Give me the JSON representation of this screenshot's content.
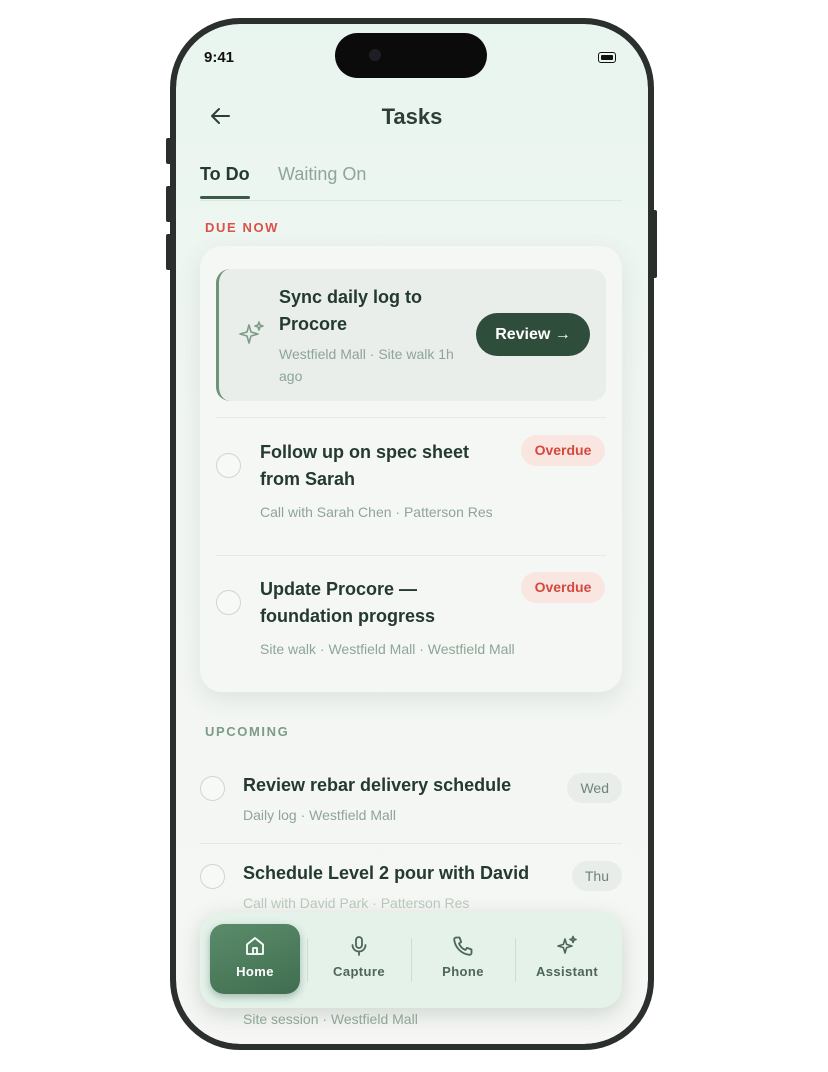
{
  "status": {
    "time": "9:41"
  },
  "header": {
    "title": "Tasks"
  },
  "tabs": [
    {
      "label": "To Do"
    },
    {
      "label": "Waiting On"
    }
  ],
  "due_now": {
    "label": "DUE NOW",
    "hero": {
      "title": "Sync daily log to Procore",
      "meta": "Westfield Mall · Site walk 1h ago",
      "action_label": "Review →",
      "icon": "sparkle-icon"
    },
    "tasks": [
      {
        "title": "Follow up on spec sheet from Sarah",
        "meta": "Call with Sarah Chen · Patterson Res",
        "badge": "Overdue"
      },
      {
        "title": "Update Procore — foundation progress",
        "meta": "Site walk · Westfield Mall · Westfield Mall",
        "badge": "Overdue"
      }
    ]
  },
  "upcoming": {
    "label": "UPCOMING",
    "tasks": [
      {
        "title": "Review rebar delivery schedule",
        "meta": "Daily log · Westfield Mall",
        "day": "Wed"
      },
      {
        "title": "Schedule Level 2 pour with David",
        "meta": "Call with David Park · Patterson Res",
        "day": "Thu"
      }
    ],
    "peek_meta": "Site session · Westfield Mall"
  },
  "nav": {
    "items": [
      {
        "label": "Home",
        "icon": "home-icon"
      },
      {
        "label": "Capture",
        "icon": "microphone-icon"
      },
      {
        "label": "Phone",
        "icon": "phone-icon"
      },
      {
        "label": "Assistant",
        "icon": "sparkle-icon"
      }
    ]
  },
  "colors": {
    "accent": "#2e4d3b",
    "overdue": "#d6473d",
    "due_label": "#d9534a",
    "muted": "#8ea597"
  }
}
